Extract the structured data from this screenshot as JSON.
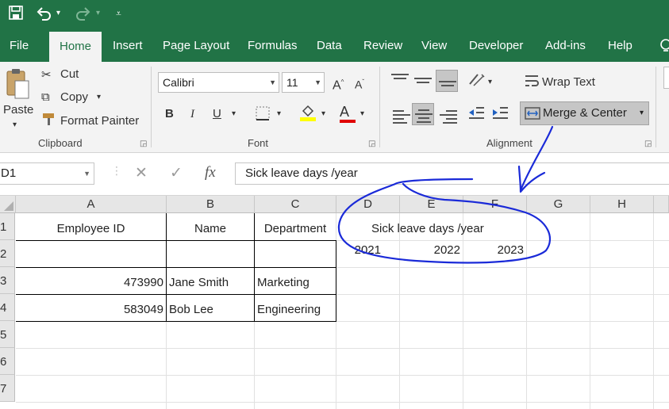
{
  "ribbon_tabs": [
    "File",
    "Home",
    "Insert",
    "Page Layout",
    "Formulas",
    "Data",
    "Review",
    "View",
    "Developer",
    "Add-ins",
    "Help"
  ],
  "active_tab": "Home",
  "clipboard": {
    "paste": "Paste",
    "cut": "Cut",
    "copy": "Copy",
    "format_painter": "Format Painter",
    "group_label": "Clipboard"
  },
  "font": {
    "name": "Calibri",
    "size": "11",
    "bold": "B",
    "italic": "I",
    "underline": "U",
    "group_label": "Font",
    "grow": "A",
    "shrink": "A",
    "font_color_letter": "A"
  },
  "alignment": {
    "wrap_text": "Wrap Text",
    "merge_center": "Merge & Center",
    "group_label": "Alignment"
  },
  "formula_bar": {
    "name_box": "D1",
    "fx": "fx",
    "cancel": "✕",
    "enter": "✓",
    "value": "Sick leave days /year"
  },
  "grid": {
    "columns": [
      "A",
      "B",
      "C",
      "D",
      "E",
      "F",
      "G",
      "H"
    ],
    "rows": [
      "1",
      "2",
      "3",
      "4",
      "5",
      "6",
      "7"
    ],
    "cells": {
      "A1": "Employee ID",
      "B1": "Name",
      "C1": "Department",
      "D1": "Sick leave days /year",
      "D2": "2021",
      "E2": "2022",
      "F2": "2023",
      "A3": "473990",
      "B3": "Jane Smith",
      "C3": "Marketing",
      "A4": "583049",
      "B4": "Bob Lee",
      "C4": "Engineering"
    }
  },
  "colors": {
    "excel_green": "#217346",
    "annotation_ink": "#1a2ad8",
    "ribbon_bg": "#f3f3f3",
    "header_bg": "#e6e6e6"
  }
}
